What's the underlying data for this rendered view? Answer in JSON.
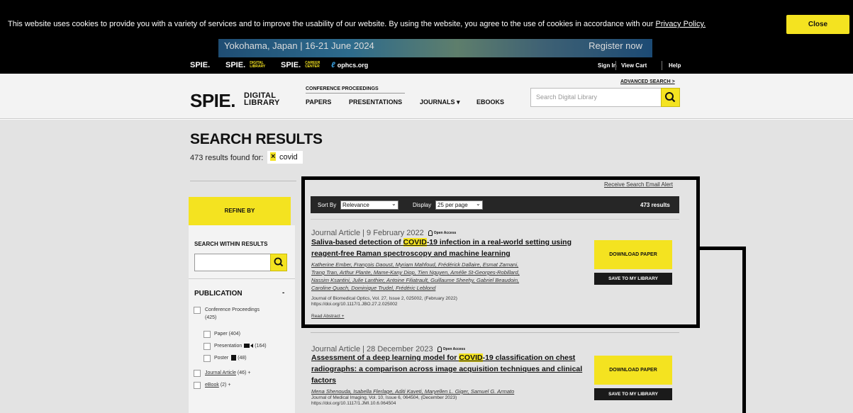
{
  "cookie": {
    "text": "This website uses cookies to provide you with a variety of services and to improve the usability of our website. By using the website, you agree to the use of cookies in accordance with our",
    "link": "Privacy Policy.",
    "close": "Close"
  },
  "banner": {
    "left": "Yokohama, Japan | 16-21 June 2024",
    "right": "Register now"
  },
  "topnav": {
    "spie": "SPIE.",
    "spie_digital": "SPIE.",
    "spie_digital_sub1": "DIGITAL",
    "spie_digital_sub2": "LIBRARY",
    "spie_career": "SPIE.",
    "spie_career_sub1": "CAREER",
    "spie_career_sub2": "CENTER",
    "ophcs": "ophcs.org",
    "signin": "Sign In",
    "viewcart": "View Cart",
    "help": "Help"
  },
  "header": {
    "logo": "SPIE.",
    "logo_sub1": "DIGITAL",
    "logo_sub2": "LIBRARY",
    "conf_label": "CONFERENCE PROCEEDINGS",
    "nav": [
      "PAPERS",
      "PRESENTATIONS",
      "JOURNALS ▾",
      "EBOOKS"
    ],
    "adv_search": "ADVANCED SEARCH >",
    "search_placeholder": "Search Digital Library"
  },
  "results_header": {
    "title": "SEARCH RESULTS",
    "count_text": "473 results found for:",
    "chip_x": "×",
    "query": "covid"
  },
  "sidebar": {
    "refine": "REFINE BY",
    "search_within": "SEARCH WITHIN RESULTS",
    "publication": "PUBLICATION",
    "publication_toggle": "-",
    "filters": [
      {
        "label": "Conference Proceedings",
        "count": "(425)"
      },
      {
        "label": "Paper",
        "count": "(404)"
      },
      {
        "label": "Presentation",
        "count": "(164)"
      },
      {
        "label": "Poster",
        "count": "(48)"
      },
      {
        "label": "Journal Article",
        "count": "(46) +"
      },
      {
        "label": "eBook",
        "count": "(2) +"
      }
    ]
  },
  "toolbar": {
    "alert": "Receive Search Email Alert",
    "sort_label": "Sort By",
    "sort_value": "Relevance",
    "display_label": "Display",
    "display_value": "25 per page",
    "results": "473 results"
  },
  "results": [
    {
      "meta": "Journal Article | 9 February 2022",
      "open_access": "Open Access",
      "title_a1": "Saliva-based detection of ",
      "title_hl": "COVID",
      "title_a2": "-19 infection in a real-world setting using",
      "title_b": "reagent-free Raman spectroscopy and machine learning",
      "authors": [
        "Katherine Ember, François Daoust, Myriam Mahfoud, Frédérick Dallaire, Esmat Zamani,",
        "Trang Tran, Arthur Plante, Mame-Kany Diop, Tien Nguyen, Amélie St-Georges-Robillard,",
        "Nassim Ksantini, Julie Lanthier, Antoine Filiatrault, Guillaume Sheehy, Gabriel Beaudoin,",
        "Caroline Quach, Dominique Trudel, Frédéric Leblond"
      ],
      "journal": "Journal of Biomedical Optics, Vol. 27, Issue 2, 025002, (February 2022)",
      "doi": "https://doi.org/10.1117/1.JBO.27.2.025002",
      "read_abstract": "Read Abstract +",
      "download": "DOWNLOAD PAPER",
      "save": "SAVE TO MY LIBRARY"
    },
    {
      "meta": "Journal Article | 28 December 2023",
      "open_access": "Open Access",
      "title_a1": "Assessment of a deep learning model for ",
      "title_hl": "COVID",
      "title_a2": "-19 classification on chest",
      "title_b": "radiographs: a comparison across image acquisition techniques and clinical",
      "title_c": "factors",
      "authors": [
        "Mena Shenouda, Isabella Flerlage, Aditi Kaveti, Maryellen L. Giger, Samuel G. Armato"
      ],
      "journal": "Journal of Medical Imaging, Vol. 10, Issue 6, 064504, (December 2023)",
      "doi": "https://doi.org/10.1117/1.JMI.10.6.064504",
      "download": "DOWNLOAD PAPER",
      "save": "SAVE TO MY LIBRARY"
    }
  ],
  "colors": {
    "accent": "#f4e320",
    "dark": "#000000",
    "panel": "#e3e3e3"
  },
  "icons": [
    "search-icon",
    "lock-icon",
    "video-icon",
    "poster-icon",
    "close-icon"
  ]
}
